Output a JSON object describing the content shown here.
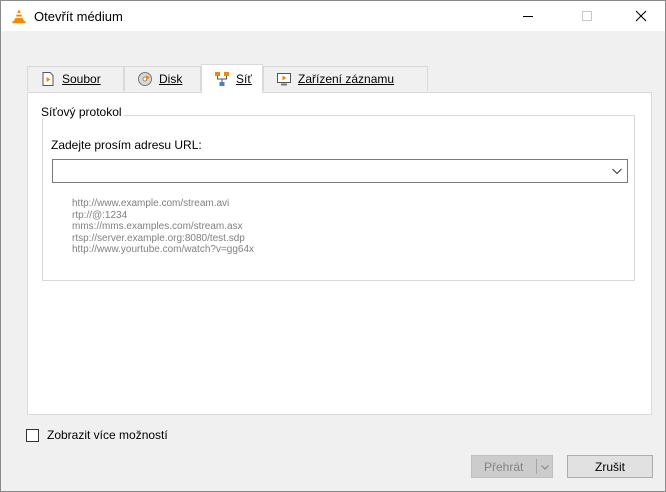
{
  "window": {
    "title": "Otevřít médium",
    "controls": [
      "minimize",
      "maximize",
      "close"
    ]
  },
  "tabs": [
    {
      "label": "Soubor",
      "icon": "file-icon",
      "active": false
    },
    {
      "label": "Disk",
      "icon": "disc-icon",
      "active": false
    },
    {
      "label": "Síť",
      "icon": "network-icon",
      "active": true
    },
    {
      "label": "Zařízení záznamu",
      "icon": "capture-device-icon",
      "active": false
    }
  ],
  "network": {
    "group_title": "Síťový protokol",
    "url_label": "Zadejte prosím adresu URL:",
    "url_value": "",
    "examples": [
      "http://www.example.com/stream.avi",
      "rtp://@:1234",
      "mms://mms.examples.com/stream.asx",
      "rtsp://server.example.org:8080/test.sdp",
      "http://www.yourtube.com/watch?v=gg64x"
    ]
  },
  "options": {
    "show_more_label": "Zobrazit více možností",
    "show_more_checked": false
  },
  "buttons": {
    "play_label": "Přehrát",
    "play_enabled": false,
    "cancel_label": "Zrušit"
  },
  "colors": {
    "vlc_orange": "#f08a00",
    "disabled_text": "#838383",
    "example_text": "#808080"
  }
}
